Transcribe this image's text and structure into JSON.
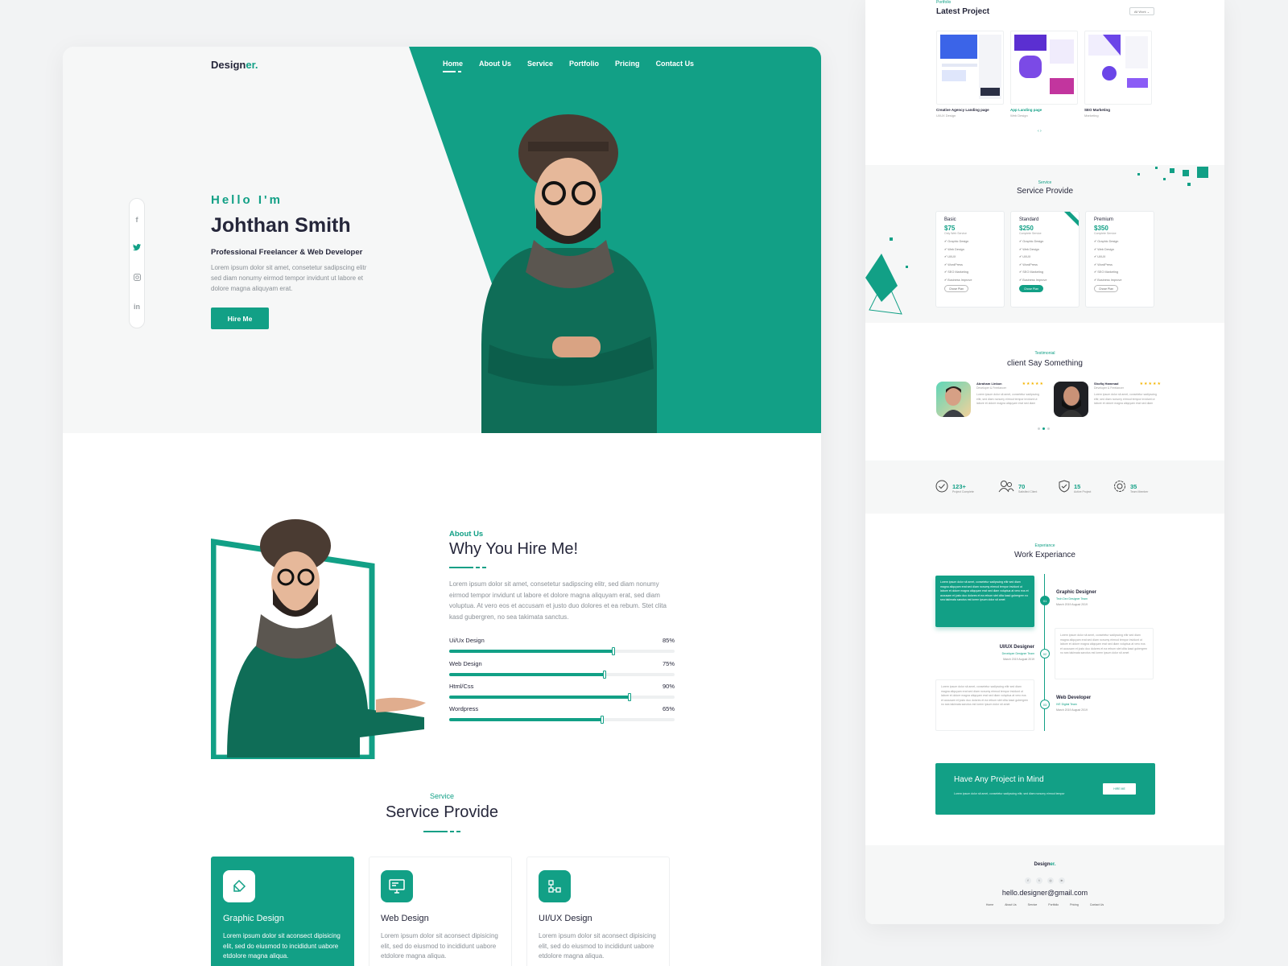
{
  "colors": {
    "accent": "#12a086",
    "dark": "#26273b",
    "muted": "#8a9096"
  },
  "logo": {
    "text": "Design",
    "accent": "er."
  },
  "nav": [
    "Home",
    "About Us",
    "Service",
    "Portfolio",
    "Pricing",
    "Contact Us"
  ],
  "social": [
    "f",
    "twitter-icon",
    "instagram-icon",
    "in"
  ],
  "hero": {
    "greeting": "Hello I'm",
    "name": "Johthan Smith",
    "role": "Professional Freelancer & Web Developer",
    "desc": "Lorem ipsum dolor sit amet, consetetur sadipscing elitr sed diam nonumy eirmod tempor invidunt ut labore et dolore magna aliquyam erat.",
    "button": "Hire Me"
  },
  "about": {
    "sub": "About Us",
    "title": "Why You Hire Me!",
    "text": "Lorem ipsum dolor sit amet, consetetur sadipscing elitr, sed diam nonumy eirmod tempor invidunt ut labore et dolore magna aliquyam erat, sed diam voluptua. At vero eos et accusam et justo duo dolores et ea rebum. Stet clita kasd gubergren, no sea takimata sanctus.",
    "skills": [
      {
        "name": "Ui/Ux Design",
        "pct_label": "85%",
        "pct": 0.73
      },
      {
        "name": "Web Design",
        "pct_label": "75%",
        "pct": 0.69
      },
      {
        "name": "Html/Css",
        "pct_label": "90%",
        "pct": 0.8
      },
      {
        "name": "Wordpress",
        "pct_label": "65%",
        "pct": 0.68
      }
    ]
  },
  "services": {
    "sub": "Service",
    "title": "Service Provide",
    "cards": [
      {
        "name": "Graphic Design",
        "desc": "Lorem ipsum dolor sit aconsect dipisicing elit, sed do eiusmod to incididunt uabore etdolore magna aliqua."
      },
      {
        "name": "Web Design",
        "desc": "Lorem ipsum dolor sit aconsect dipisicing elit, sed do eiusmod to incididunt uabore etdolore magna aliqua."
      },
      {
        "name": "UI/UX Design",
        "desc": "Lorem ipsum dolor sit aconsect dipisicing elit, sed do eiusmod to incididunt uabore etdolore magna aliqua."
      }
    ]
  },
  "right": {
    "portfolio": {
      "sub": "Portfolio",
      "title": "Latest Project",
      "select": "All Work",
      "items": [
        {
          "name": "Creative Agency Landing page",
          "cat": "UI/UX Design"
        },
        {
          "name": "App Landing page",
          "cat": "Web Design"
        },
        {
          "name": "SEO Marketing",
          "cat": "Marketing"
        }
      ]
    },
    "pricing": {
      "sub": "Service",
      "title": "Service Provide",
      "plans": [
        {
          "name": "Basic",
          "price": "$75",
          "tag": "Only Web Service",
          "button": "Chose Plan"
        },
        {
          "name": "Standard",
          "price": "$250",
          "tag": "Complete Service",
          "button": "Chose Plan"
        },
        {
          "name": "Premium",
          "price": "$350",
          "tag": "Complete Service",
          "button": "Chose Plan"
        }
      ],
      "features": [
        "Graphic Design",
        "Web Design",
        "UI/UX",
        "WordPress",
        "SEO Marketing",
        "Business Improve"
      ]
    },
    "testimonial": {
      "sub": "Testimonial",
      "title": "client Say Something",
      "items": [
        {
          "name": "Abraham Linkon",
          "role": "Developer & Freelancer",
          "stars": "★★★★★",
          "text": "Lorem ipsum dolor sit amet, consetetur sadipscing elitr, sed diam nonumy eirmod tempor invidunt ut labore et dolore magna aliquyam erat sed diam"
        },
        {
          "name": "Shofiq Hammad",
          "role": "Developer & Freelancer",
          "stars": "★★★★★",
          "text": "Lorem ipsum dolor sit amet, consetetur sadipscing elitr, sed diam nonumy eirmod tempor invidunt ut labore et dolore magna aliquyam erat sed diam"
        }
      ]
    },
    "stats": [
      {
        "num": "123+",
        "label": "Project Complete",
        "icon": "check-circle-icon"
      },
      {
        "num": "70",
        "label": "Satisfied Client",
        "icon": "users-icon"
      },
      {
        "num": "15",
        "label": "Active Project",
        "icon": "shield-icon"
      },
      {
        "num": "35",
        "label": "Team Member",
        "icon": "award-icon"
      }
    ],
    "experience": {
      "sub": "Experiance",
      "title": "Work Experiance",
      "items": [
        {
          "num": "01",
          "title": "Graphic Designer",
          "company": "Tech Dev Designer Team",
          "date": "March 2019 August 2019"
        },
        {
          "num": "02",
          "title": "UI/UX Designer",
          "company": "Developer Designer Team",
          "date": "March 2019 August 2019"
        },
        {
          "num": "03",
          "title": "Web Developer",
          "company": "IVE Digital Team",
          "date": "March 2019 August 2019"
        }
      ],
      "text": "Lorem ipsum dolor sit amet, consetetur sadipscing elitr sed diam magna aliquyam erat sed diam nonumy eirmod tempor invidunt ut labore et dolore magna aliquyam erat sed diam voluptua at vero eos et accusam et justo duo dolores et ea rebum stet clita kasd gubergren no sea takimata sanctus est lorem ipsum dolor sit amet"
    },
    "cta": {
      "title": "Have Any Project in Mind",
      "desc": "Lorem ipsum dolor sit amet, consetetur sadipscing elitr, sed diam nonumy eirmod tempor",
      "button": "HIRE ME"
    },
    "footer": {
      "logo": "Design",
      "logo_accent": "er.",
      "email": "hello.designer@gmail.com",
      "nav": [
        "Home",
        "About Us",
        "Service",
        "Portfolio",
        "Pricing",
        "Contact Us"
      ]
    }
  }
}
